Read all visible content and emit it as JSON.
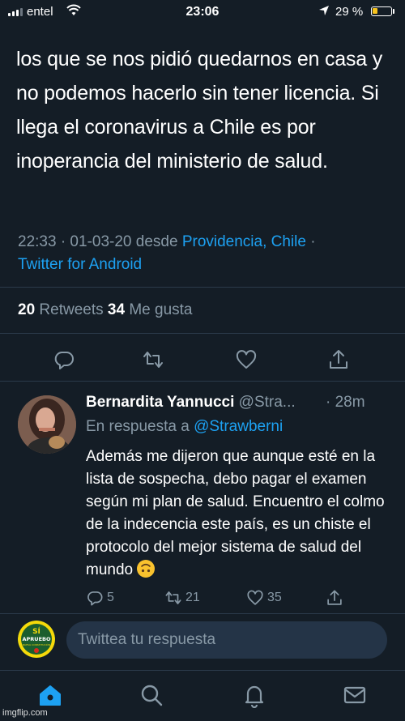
{
  "status_bar": {
    "carrier": "entel",
    "time": "23:06",
    "battery": "29 %",
    "battery_level": 0.29,
    "icons": [
      "signal-icon",
      "wifi-icon",
      "location-arrow-icon",
      "battery-icon"
    ]
  },
  "tweet": {
    "text": "los que se nos pidió quedarnos en casa y no podemos hacerlo sin tener licencia. Si llega el coronavirus a Chile es por inoperancia del ministerio de salud.",
    "time": "22:33 · 01-03-20 desde ",
    "location": "Providencia, Chile",
    "separator": " ·",
    "client": "Twitter for Android",
    "retweets_count": "20",
    "retweets_label": " Retweets ",
    "likes_count": "34",
    "likes_label": " Me gusta",
    "actions": [
      "reply-icon",
      "retweet-icon",
      "like-icon",
      "share-icon"
    ]
  },
  "reply": {
    "name": "Bernardita Yannucci",
    "handle": " @Stra...",
    "time": "· 28m",
    "reply_to_prefix": "En respuesta a ",
    "reply_to_handle": "@Strawberni",
    "text": "Además me dijeron que aunque esté en la lista de sospecha, debo pagar el examen según mi plan de salud. Encuentro el colmo de la indecencia este país, es un chiste el protocolo del mejor sistema de salud del mundo",
    "emoji": "upside-down-face",
    "replies": "5",
    "retweets": "21",
    "likes": "35"
  },
  "compose": {
    "placeholder": "Twittea tu respuesta",
    "badge_line1": "SÍ",
    "badge_line2": "APRUEBO",
    "badge_line3": "NUEVA CONSTITUCIÓN"
  },
  "tab_bar": {
    "tabs": [
      "home-icon",
      "search-icon",
      "notifications-icon",
      "messages-icon"
    ],
    "accent": "#1da1f2"
  },
  "watermark": "imgflip.com"
}
